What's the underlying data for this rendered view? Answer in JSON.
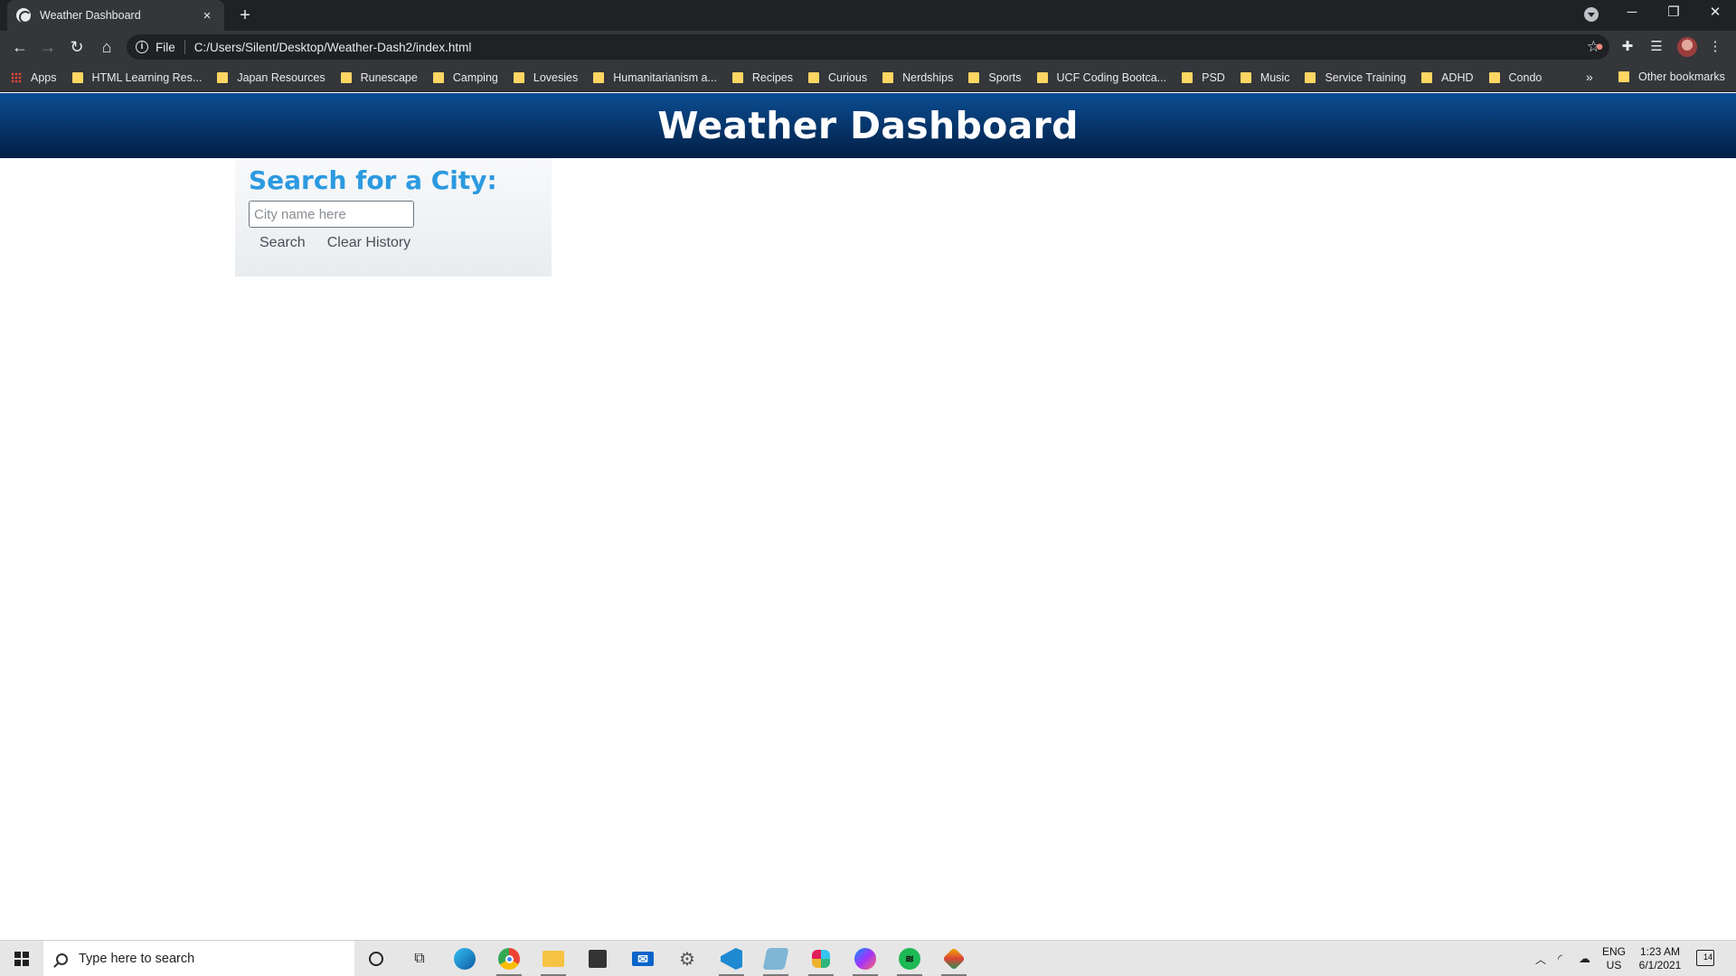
{
  "browser": {
    "tab_title": "Weather Dashboard",
    "tab_close": "×",
    "new_tab": "+",
    "scheme": "File",
    "url": "C:/Users/Silent/Desktop/Weather-Dash2/index.html",
    "window_minimize": "─",
    "window_restore": "❐",
    "window_close": "✕"
  },
  "bookmarks": {
    "apps_label": "Apps",
    "items": [
      {
        "label": "HTML Learning Res..."
      },
      {
        "label": "Japan Resources"
      },
      {
        "label": "Runescape"
      },
      {
        "label": "Camping"
      },
      {
        "label": "Lovesies"
      },
      {
        "label": "Humanitarianism a..."
      },
      {
        "label": "Recipes"
      },
      {
        "label": "Curious"
      },
      {
        "label": "Nerdships"
      },
      {
        "label": "Sports"
      },
      {
        "label": "UCF Coding Bootca..."
      },
      {
        "label": "PSD"
      },
      {
        "label": "Music"
      },
      {
        "label": "Service Training"
      },
      {
        "label": "ADHD"
      },
      {
        "label": "Condo"
      }
    ],
    "overflow": "»",
    "other_label": "Other bookmarks"
  },
  "page": {
    "header_title": "Weather Dashboard",
    "search_heading": "Search for a City:",
    "city_placeholder": "City name here",
    "city_value": "",
    "search_button": "Search",
    "clear_button": "Clear History"
  },
  "taskbar": {
    "search_placeholder": "Type here to search",
    "language": "ENG",
    "region": "US",
    "time": "1:23 AM",
    "date": "6/1/2021",
    "notification_count": "14"
  },
  "colors": {
    "header_top": "#0b4d93",
    "header_bottom": "#021f45",
    "search_heading": "#2c9ae0",
    "chrome_dark": "#202124",
    "chrome_toolbar": "#35363a"
  }
}
